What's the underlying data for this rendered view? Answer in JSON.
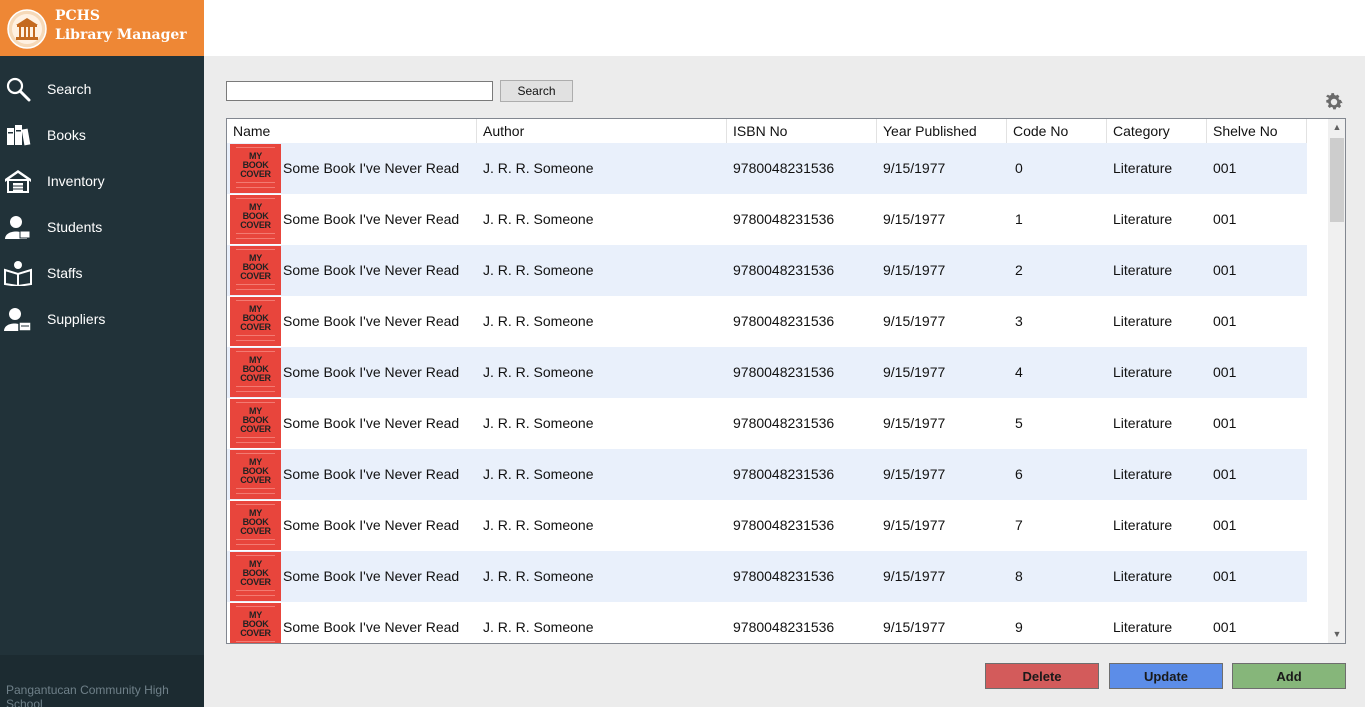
{
  "app": {
    "title_line1": "PCHS",
    "title_line2": "Library Manager",
    "footer": "Pangantucan Community High School"
  },
  "sidebar": {
    "items": [
      {
        "label": "Search",
        "icon": "search-icon"
      },
      {
        "label": "Books",
        "icon": "books-icon"
      },
      {
        "label": "Inventory",
        "icon": "warehouse-icon"
      },
      {
        "label": "Students",
        "icon": "student-icon"
      },
      {
        "label": "Staffs",
        "icon": "staff-book-icon"
      },
      {
        "label": "Suppliers",
        "icon": "supplier-icon"
      }
    ]
  },
  "search": {
    "value": "",
    "placeholder": "",
    "button_label": "Search"
  },
  "settings_icon": "gear-icon",
  "table": {
    "columns": [
      "Name",
      "Author",
      "ISBN No",
      "Year Published",
      "Code No",
      "Category",
      "Shelve No"
    ],
    "cover_text": [
      "MY",
      "BOOK",
      "COVER"
    ],
    "rows": [
      {
        "name": "Some Book I've Never Read",
        "author": "J. R. R. Someone",
        "isbn": "9780048231536",
        "year": "9/15/1977",
        "code": "0",
        "category": "Literature",
        "shelve": "001"
      },
      {
        "name": "Some Book I've Never Read",
        "author": "J. R. R. Someone",
        "isbn": "9780048231536",
        "year": "9/15/1977",
        "code": "1",
        "category": "Literature",
        "shelve": "001"
      },
      {
        "name": "Some Book I've Never Read",
        "author": "J. R. R. Someone",
        "isbn": "9780048231536",
        "year": "9/15/1977",
        "code": "2",
        "category": "Literature",
        "shelve": "001"
      },
      {
        "name": "Some Book I've Never Read",
        "author": "J. R. R. Someone",
        "isbn": "9780048231536",
        "year": "9/15/1977",
        "code": "3",
        "category": "Literature",
        "shelve": "001"
      },
      {
        "name": "Some Book I've Never Read",
        "author": "J. R. R. Someone",
        "isbn": "9780048231536",
        "year": "9/15/1977",
        "code": "4",
        "category": "Literature",
        "shelve": "001"
      },
      {
        "name": "Some Book I've Never Read",
        "author": "J. R. R. Someone",
        "isbn": "9780048231536",
        "year": "9/15/1977",
        "code": "5",
        "category": "Literature",
        "shelve": "001"
      },
      {
        "name": "Some Book I've Never Read",
        "author": "J. R. R. Someone",
        "isbn": "9780048231536",
        "year": "9/15/1977",
        "code": "6",
        "category": "Literature",
        "shelve": "001"
      },
      {
        "name": "Some Book I've Never Read",
        "author": "J. R. R. Someone",
        "isbn": "9780048231536",
        "year": "9/15/1977",
        "code": "7",
        "category": "Literature",
        "shelve": "001"
      },
      {
        "name": "Some Book I've Never Read",
        "author": "J. R. R. Someone",
        "isbn": "9780048231536",
        "year": "9/15/1977",
        "code": "8",
        "category": "Literature",
        "shelve": "001"
      },
      {
        "name": "Some Book I've Never Read",
        "author": "J. R. R. Someone",
        "isbn": "9780048231536",
        "year": "9/15/1977",
        "code": "9",
        "category": "Literature",
        "shelve": "001"
      }
    ]
  },
  "actions": {
    "delete_label": "Delete",
    "update_label": "Update",
    "add_label": "Add"
  },
  "colors": {
    "brand_orange": "#ee8735",
    "sidebar_bg": "#213239",
    "row_alt": "#e9f0fb",
    "delete": "#d35b5b",
    "update": "#5c8de8",
    "add": "#86b67a"
  }
}
